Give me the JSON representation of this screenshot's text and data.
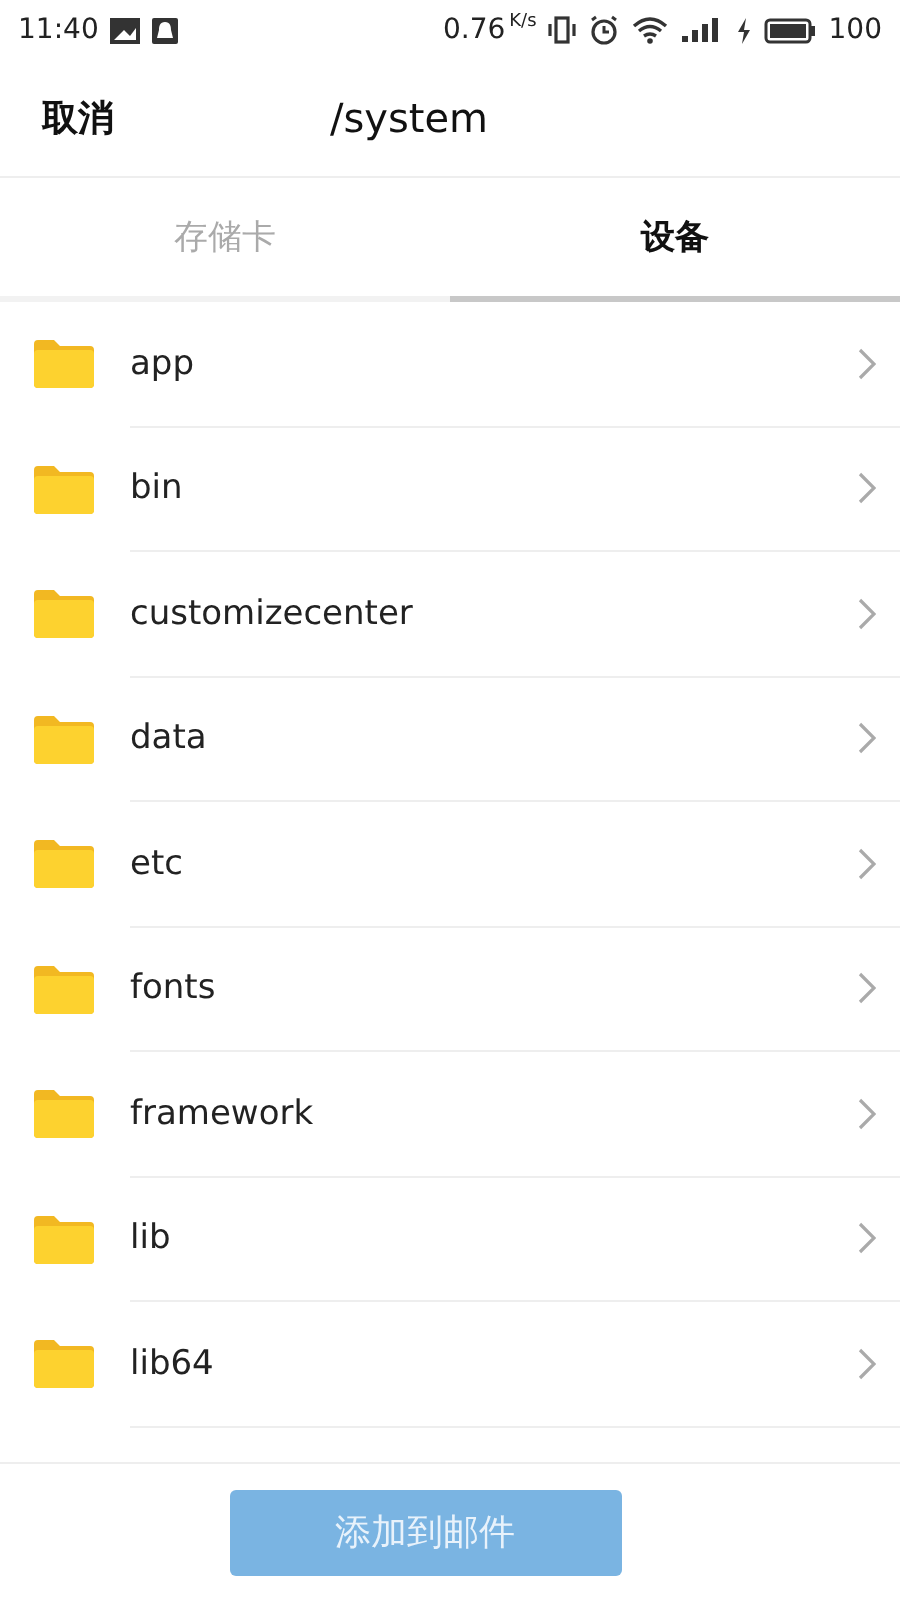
{
  "status_bar": {
    "time": "11:40",
    "speed": "0.76",
    "speed_unit": "K/s",
    "battery": "100"
  },
  "header": {
    "cancel": "取消",
    "path": "/system"
  },
  "tabs": [
    {
      "label": "存储卡",
      "selected": false
    },
    {
      "label": "设备",
      "selected": true
    }
  ],
  "folders": [
    {
      "name": "app"
    },
    {
      "name": "bin"
    },
    {
      "name": "customizecenter"
    },
    {
      "name": "data"
    },
    {
      "name": "etc"
    },
    {
      "name": "fonts"
    },
    {
      "name": "framework"
    },
    {
      "name": "lib"
    },
    {
      "name": "lib64"
    }
  ],
  "button": {
    "label": "添加到邮件",
    "disabled": true
  }
}
